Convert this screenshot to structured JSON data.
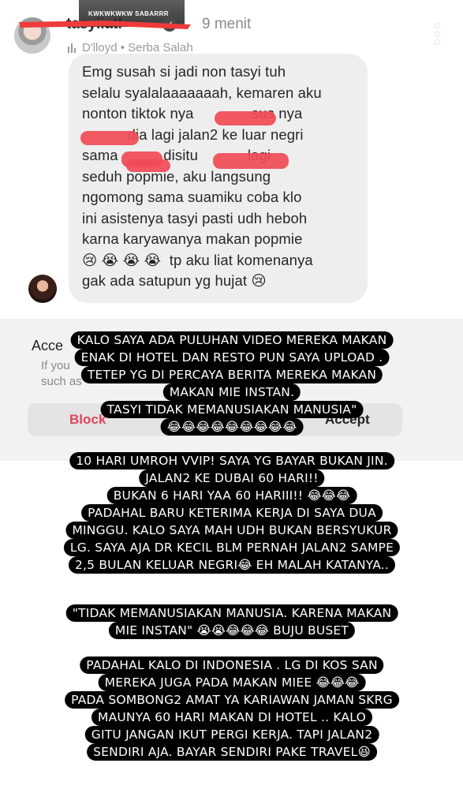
{
  "story": {
    "username": "tasyiiatl",
    "verified_mark": "✓",
    "time": "9 menit",
    "music": "D'lloyd • Serba Salah",
    "screenshot_tag": "KWKWKWKW SABARRR"
  },
  "dm": {
    "lines": [
      "Emg susah si jadi non tasyi tuh",
      "selalu syalalaaaaaaah, kemaren aku",
      "nonton tiktok nya              sus nya",
      "           dia lagi jalan2 ke luar negri",
      "sama           disitu            lagi",
      "seduh popmie, aku langsung",
      "ngomong sama suamiku coba klo",
      "ini asistenya tasyi pasti udh heboh",
      "karna karyawanya makan popmie",
      "😢 😭 😭 😭  tp aku liat komenanya",
      "gak ada satupun yg hujat 😢"
    ]
  },
  "request": {
    "title": "Acce",
    "desc_1": "If you",
    "desc_2": "such as",
    "block": "Block",
    "accept": "Accept"
  },
  "captions": {
    "block1": [
      "KALO SAYA ADA PULUHAN VIDEO MEREKA MAKAN",
      "ENAK DI HOTEL DAN RESTO PUN SAYA UPLOAD .",
      "TETEP YG DI PERCAYA BERITA MEREKA MAKAN",
      "MAKAN MIE INSTAN.",
      "TASYI  TIDAK MEMANUSIAKAN MANUSIA\"",
      "😂😂😂😂😂😂😂😂😂"
    ],
    "block2": [
      "10 HARI UMROH VVIP! SAYA YG BAYAR BUKAN JIN.",
      "JALAN2 KE DUBAI 60 HARI!!",
      "BUKAN 6 HARI YAA 60 HARIII!! 😂😂😂",
      "PADAHAL BARU KETERIMA KERJA DI SAYA DUA",
      "MINGGU. KALO SAYA MAH UDH BUKAN BERSYUKUR",
      "LG. SAYA AJA DR KECIL BLM PERNAH JALAN2 SAMPE",
      "2,5 BULAN KELUAR NEGRI😂 EH MALAH KATANYA.."
    ],
    "block3": [
      "\"TIDAK MEMANUSIAKAN MANUSIA. KARENA  MAKAN",
      "MIE INSTAN\" 😭😭😂😂😂 BUJU BUSET"
    ],
    "block4": [
      "PADAHAL KALO DI INDONESIA . LG DI KOS SAN",
      "MEREKA JUGA PADA MAKAN MIEE 😂😂😂",
      "PADA SOMBONG2 AMAT YA KARIAWAN JAMAN SKRG",
      "MAUNYA 60 HARI MAKAN DI HOTEL .. KALO",
      "GITU JANGAN IKUT PERGI KERJA. TAPI JALAN2",
      "SENDIRI AJA. BAYAR SENDIRI PAKE TRAVEL😆"
    ]
  },
  "colors": {
    "caption_bg": "#000000",
    "caption_text": "#ffffff",
    "bubble_bg": "#eeeeee",
    "scribble": "#ee3b3b",
    "block_red": "#e0455a"
  }
}
